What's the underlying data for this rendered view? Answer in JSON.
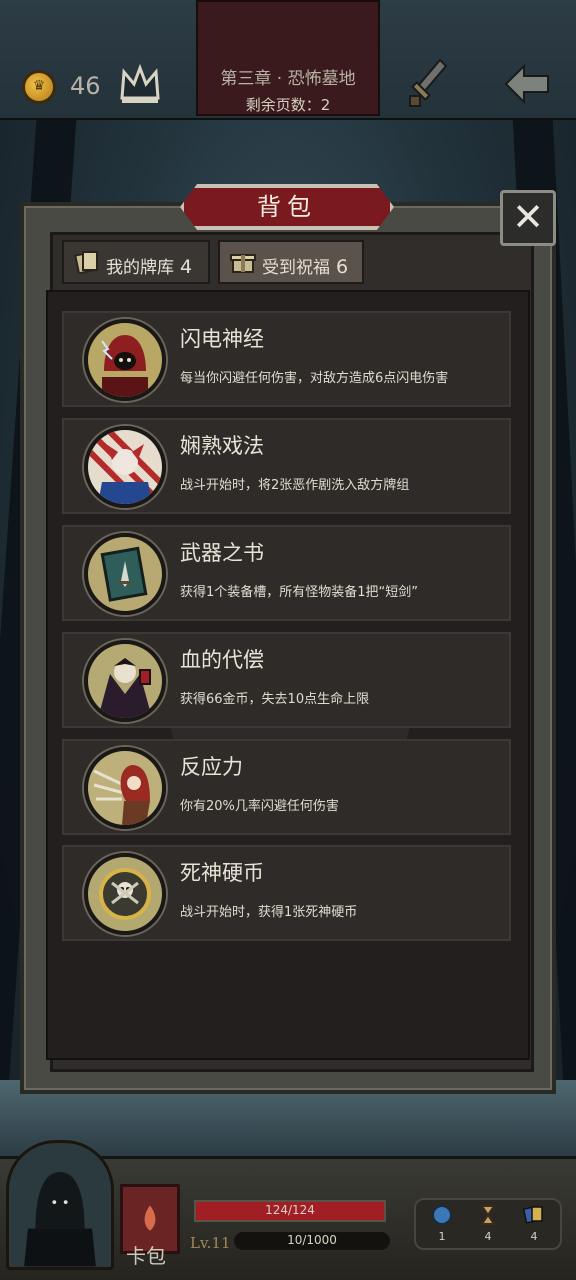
{
  "header": {
    "coins": "46",
    "chapter_title": "第三章 · 恐怖墓地",
    "pages_left": "剩余页数：2"
  },
  "panel": {
    "title": "背包",
    "close_label": "✕",
    "tabs": [
      {
        "label": "我的牌库",
        "count": "4",
        "icon": "card-icon",
        "selected": false
      },
      {
        "label": "受到祝福",
        "count": "6",
        "icon": "gift-icon",
        "selected": true
      }
    ],
    "blessings": [
      {
        "name": "闪电神经",
        "desc": "每当你闪避任何伤害，对敌方造成6点闪电伤害",
        "icon": "hooded-lightning-portrait"
      },
      {
        "name": "娴熟戏法",
        "desc": "战斗开始时，将2张恶作剧洗入敌方牌组",
        "icon": "jester-portrait"
      },
      {
        "name": "武器之书",
        "desc": "获得1个装备槽，所有怪物装备1把“短剑”",
        "icon": "weapon-book-portrait"
      },
      {
        "name": "血的代偿",
        "desc": "获得66金币，失去10点生命上限",
        "icon": "vampire-portrait"
      },
      {
        "name": "反应力",
        "desc": "你有20%几率闪避任何伤害",
        "icon": "red-hood-dodge-portrait"
      },
      {
        "name": "死神硬币",
        "desc": "战斗开始时，获得1张死神硬币",
        "icon": "death-coin-portrait"
      }
    ]
  },
  "footer": {
    "card_bag_label": "卡包",
    "hp_text": "124/124",
    "hp_fraction": 1.0,
    "level": "Lv.11",
    "xp_text": "10/1000",
    "stats": [
      {
        "icon": "orb-icon",
        "value": "1"
      },
      {
        "icon": "hourglass-icon",
        "value": "4"
      },
      {
        "icon": "cards-icon",
        "value": "4"
      }
    ]
  },
  "colors": {
    "accent_red": "#7a1a1e",
    "hp_red": "#a11f24",
    "panel_dark": "#221f1e"
  }
}
